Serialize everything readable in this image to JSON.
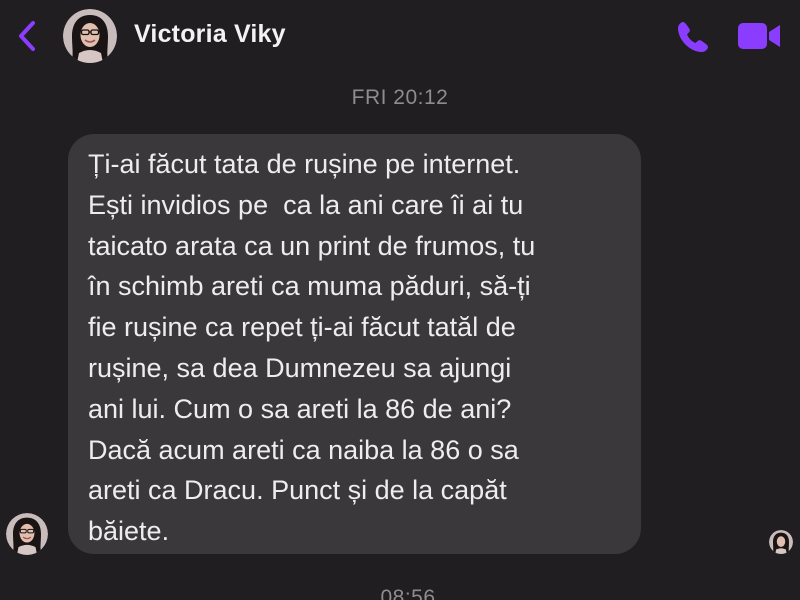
{
  "header": {
    "contact_name": "Victoria Viky",
    "back_icon": "chevron-left-icon",
    "call_icon": "phone-icon",
    "video_icon": "video-camera-icon",
    "accent_color": "#8b3dff"
  },
  "conversation": {
    "timestamp_top": "FRI 20:12",
    "message": "Ți-ai făcut tata de rușine pe internet.\nEști invidios pe  ca la ani care îi ai tu\ntaicato arata ca un print de frumos, tu\nîn schimb areti ca muma păduri, să-ți\nfie rușine ca repet ți-ai făcut tatăl de\nrușine, sa dea Dumnezeu sa ajungi\nani lui. Cum o sa areti la 86 de ani?\nDacă acum areti ca naiba la 86 o sa\nareti ca Dracu. Punct și de la capăt\nbăiete.",
    "timestamp_bottom": "08:56"
  },
  "colors": {
    "background": "#201e20",
    "bubble": "#3a383b",
    "text": "#ededed",
    "timestamp": "#8e8c8f"
  }
}
